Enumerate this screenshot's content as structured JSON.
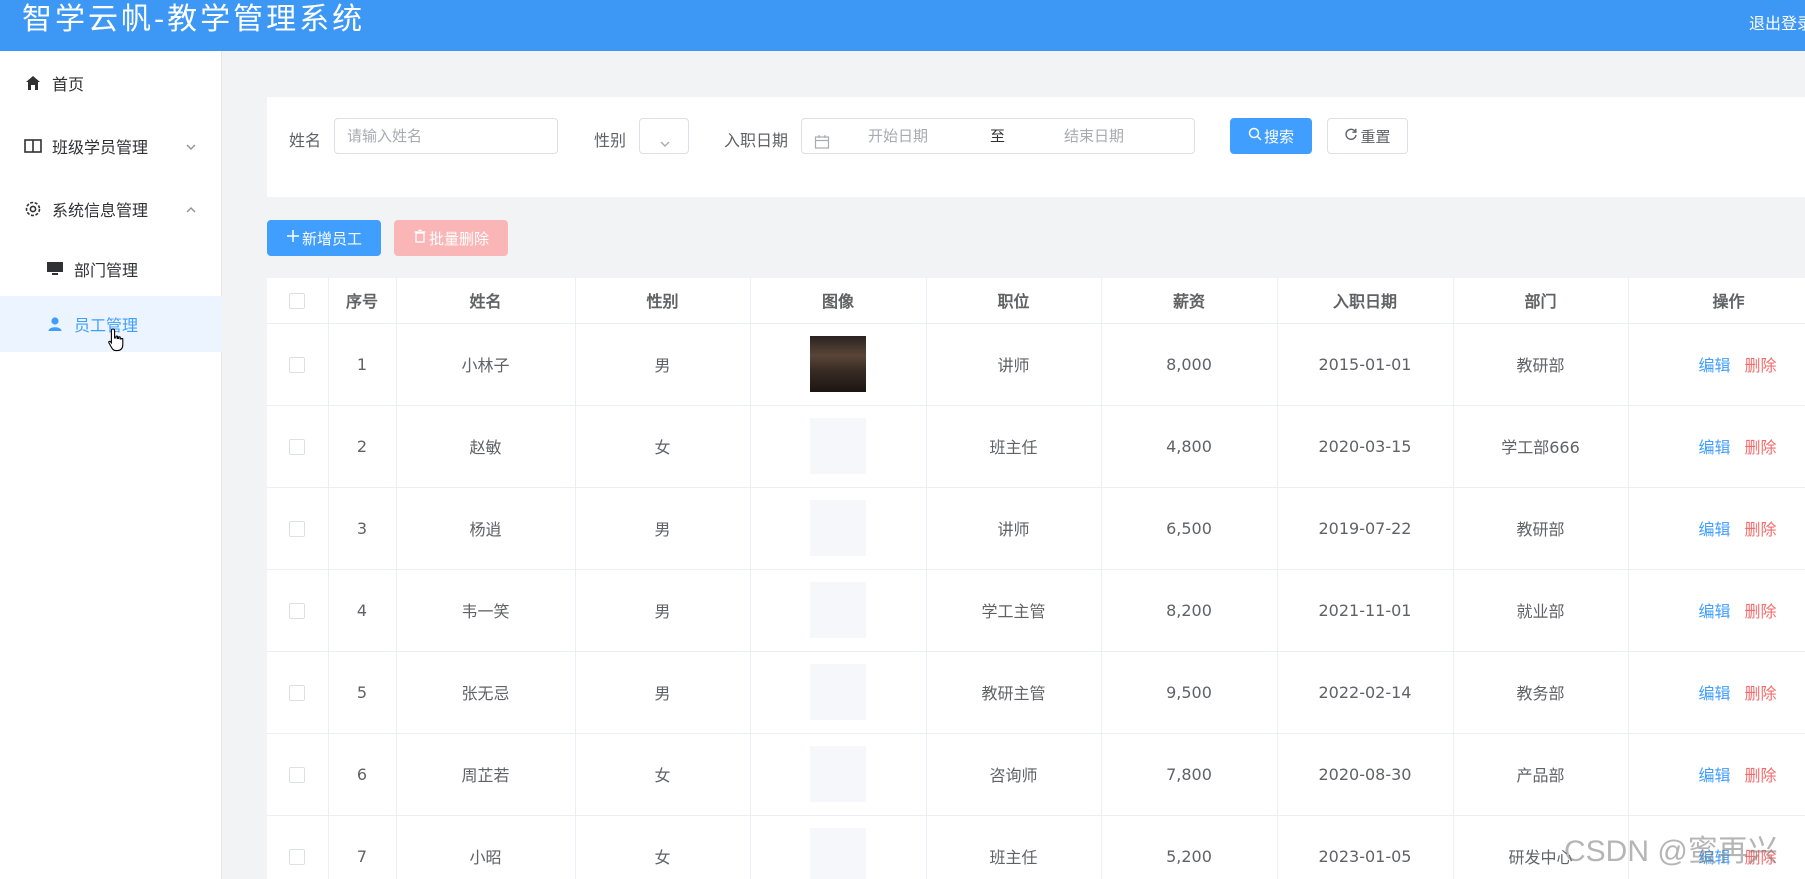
{
  "header": {
    "title": "智学云帆-教学管理系统",
    "logout": "退出登录"
  },
  "sidebar": {
    "items": [
      {
        "label": "首页",
        "icon": "home-icon"
      },
      {
        "label": "班级学员管理",
        "icon": "book-icon"
      },
      {
        "label": "系统信息管理",
        "icon": "gear-icon"
      },
      {
        "label": "部门管理",
        "icon": "monitor-icon"
      },
      {
        "label": "员工管理",
        "icon": "user-icon"
      }
    ]
  },
  "search": {
    "name_label": "姓名",
    "name_placeholder": "请输入姓名",
    "gender_label": "性别",
    "date_label": "入职日期",
    "start_placeholder": "开始日期",
    "separator": "至",
    "end_placeholder": "结束日期",
    "search_button": "搜索",
    "reset_button": "重置"
  },
  "toolbar": {
    "add_button": "新增员工",
    "batch_delete_button": "批量删除"
  },
  "table": {
    "columns": [
      "序号",
      "姓名",
      "性别",
      "图像",
      "职位",
      "薪资",
      "入职日期",
      "部门",
      "操作"
    ],
    "edit_label": "编辑",
    "delete_label": "删除",
    "rows": [
      {
        "no": "1",
        "name": "小林子",
        "gender": "男",
        "photo": true,
        "job": "讲师",
        "salary": "8,000",
        "date": "2015-01-01",
        "dept": "教研部"
      },
      {
        "no": "2",
        "name": "赵敏",
        "gender": "女",
        "photo": false,
        "job": "班主任",
        "salary": "4,800",
        "date": "2020-03-15",
        "dept": "学工部666"
      },
      {
        "no": "3",
        "name": "杨逍",
        "gender": "男",
        "photo": false,
        "job": "讲师",
        "salary": "6,500",
        "date": "2019-07-22",
        "dept": "教研部"
      },
      {
        "no": "4",
        "name": "韦一笑",
        "gender": "男",
        "photo": false,
        "job": "学工主管",
        "salary": "8,200",
        "date": "2021-11-01",
        "dept": "就业部"
      },
      {
        "no": "5",
        "name": "张无忌",
        "gender": "男",
        "photo": false,
        "job": "教研主管",
        "salary": "9,500",
        "date": "2022-02-14",
        "dept": "教务部"
      },
      {
        "no": "6",
        "name": "周芷若",
        "gender": "女",
        "photo": false,
        "job": "咨询师",
        "salary": "7,800",
        "date": "2020-08-30",
        "dept": "产品部"
      },
      {
        "no": "7",
        "name": "小昭",
        "gender": "女",
        "photo": false,
        "job": "班主任",
        "salary": "5,200",
        "date": "2023-01-05",
        "dept": "研发中心"
      }
    ]
  },
  "watermark": "CSDN @蜜再兴",
  "colors": {
    "header_bg": "#3d97f4",
    "primary": "#409eff",
    "danger": "#f56c6c",
    "danger_disabled": "#fab6b6",
    "active_bg": "#ecf5ff"
  }
}
